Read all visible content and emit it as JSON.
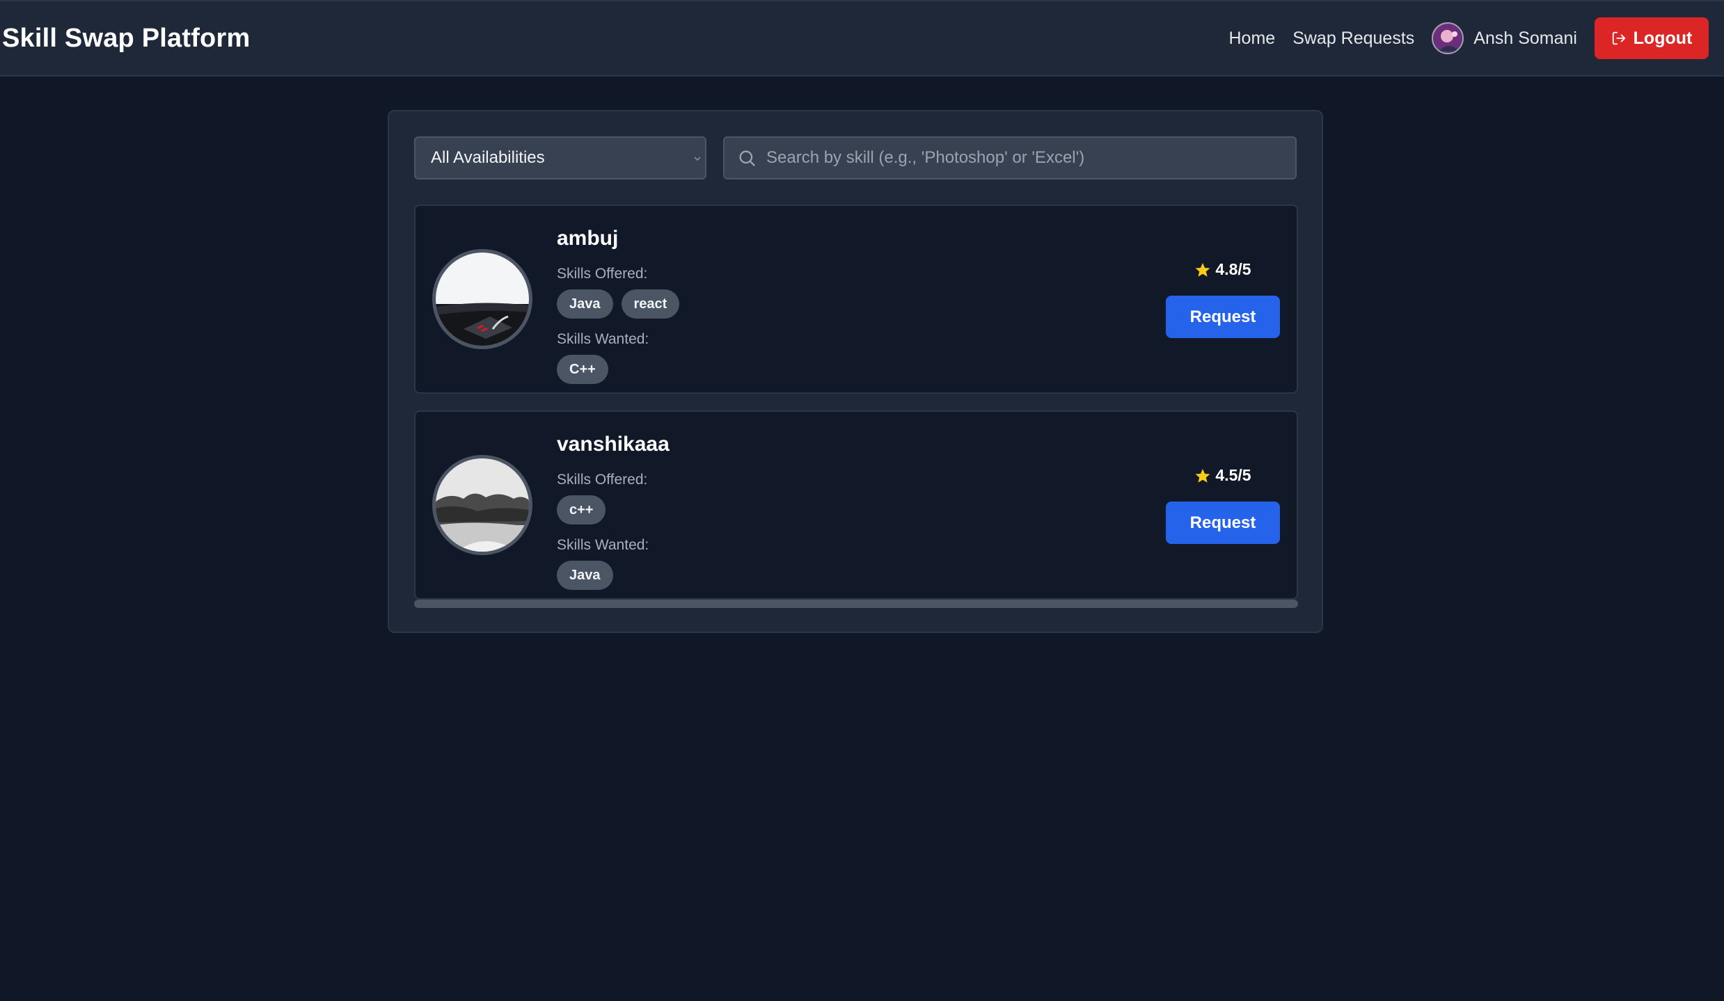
{
  "header": {
    "brand": "Skill Swap Platform",
    "nav": {
      "home": "Home",
      "swap_requests": "Swap Requests"
    },
    "user_name": "Ansh Somani",
    "logout_label": "Logout"
  },
  "filters": {
    "availability_selected": "All Availabilities",
    "search_placeholder": "Search by skill (e.g., 'Photoshop' or 'Excel')"
  },
  "users": [
    {
      "name": "ambuj",
      "skills_offered_label": "Skills Offered:",
      "skills_offered": [
        "Java",
        "react"
      ],
      "skills_wanted_label": "Skills Wanted:",
      "skills_wanted": [
        "C++"
      ],
      "rating": "4.8/5",
      "request_label": "Request"
    },
    {
      "name": "vanshikaaa",
      "skills_offered_label": "Skills Offered:",
      "skills_offered": [
        "c++"
      ],
      "skills_wanted_label": "Skills Wanted:",
      "skills_wanted": [
        "Java"
      ],
      "rating": "4.5/5",
      "request_label": "Request"
    }
  ],
  "colors": {
    "background": "#101827",
    "header": "#1e2838",
    "logout": "#dc2626",
    "request": "#2563eb",
    "star": "#facc15",
    "tag": "#4b5563"
  }
}
